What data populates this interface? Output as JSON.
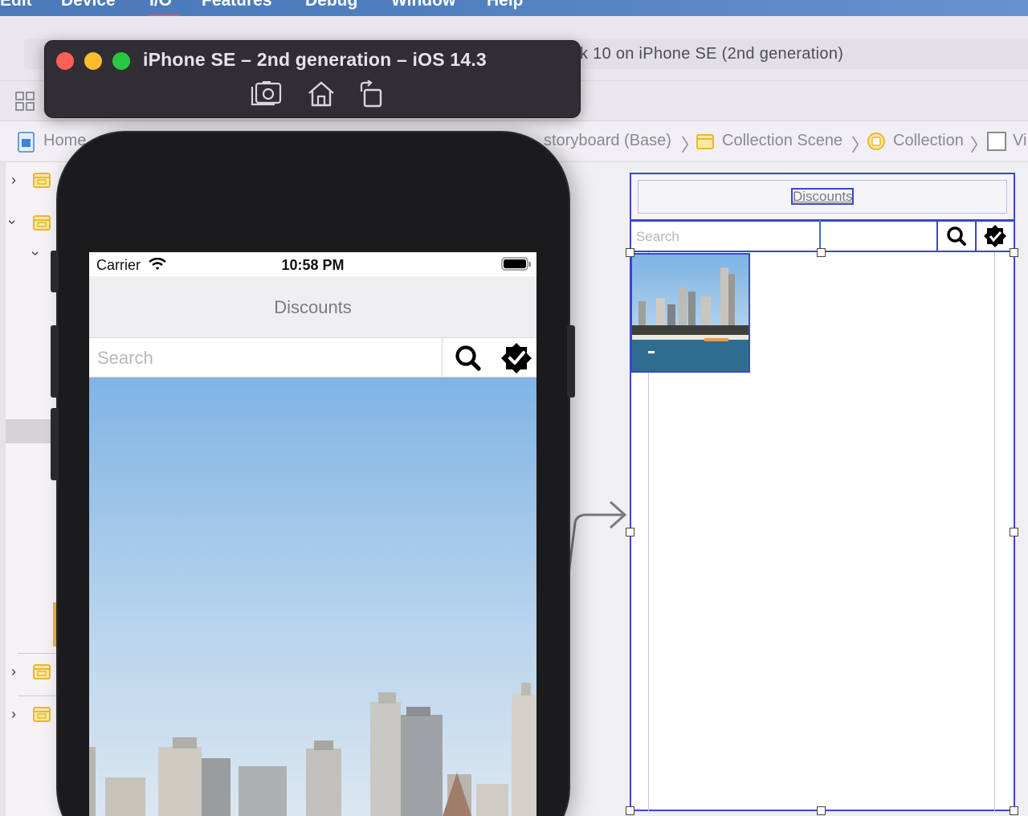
{
  "menubar": {
    "items": [
      "Edit",
      "Device",
      "I/O",
      "Features",
      "Debug",
      "Window",
      "Help"
    ]
  },
  "xcode": {
    "scheme_status": "k 10 on iPhone SE (2nd generation)",
    "jumpbar": {
      "root": "Home",
      "storyboard": "storyboard (Base)",
      "scene": "Collection Scene",
      "controller": "Collection",
      "view": "Vi"
    }
  },
  "simulator": {
    "title": "iPhone SE – 2nd generation – iOS 14.3",
    "tools": [
      "screenshot-icon",
      "home-icon",
      "rotate-icon"
    ],
    "status_bar": {
      "carrier": "Carrier",
      "time": "10:58 PM"
    },
    "nav_title": "Discounts",
    "search_placeholder": "Search"
  },
  "storyboard": {
    "nav_title": "Discounts",
    "search_placeholder": "Search"
  },
  "colors": {
    "selection_blue": "#3a45d6",
    "menubar_blue": "#4f7fc0",
    "traffic_red": "#fe5f57",
    "traffic_yellow": "#febc2e",
    "traffic_green": "#28c840",
    "scene_icon_yellow": "#e8b92d"
  }
}
